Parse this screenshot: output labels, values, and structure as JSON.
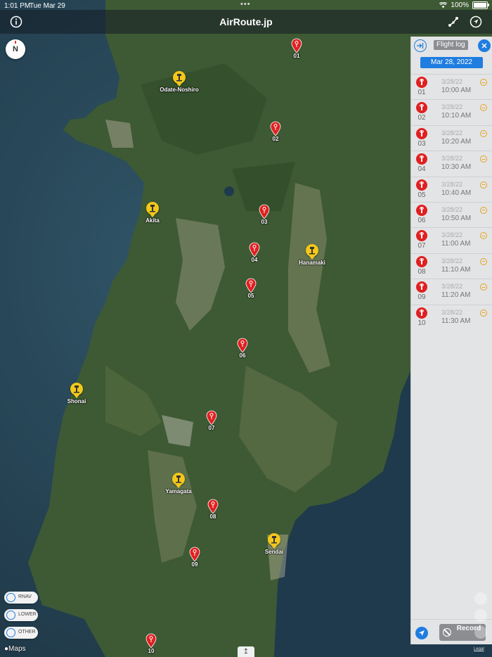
{
  "status_bar": {
    "time": "1:01 PM",
    "date": "Tue Mar 29",
    "battery": "100%"
  },
  "top_bar": {
    "title": "AirRoute.jp"
  },
  "compass": {
    "label": "N"
  },
  "airports": [
    {
      "name": "Odate-Noshiro"
    },
    {
      "name": "Akita"
    },
    {
      "name": "Hanamaki"
    },
    {
      "name": "Shonai"
    },
    {
      "name": "Yamagata"
    },
    {
      "name": "Sendai"
    }
  ],
  "waypoints": [
    "01",
    "02",
    "03",
    "04",
    "05",
    "06",
    "07",
    "08",
    "09",
    "10"
  ],
  "flight_log": {
    "title": "Flight log",
    "date": "Mar 28, 2022",
    "entries": [
      {
        "num": "01",
        "date": "3/28/22",
        "time": "10:00 AM"
      },
      {
        "num": "02",
        "date": "3/28/22",
        "time": "10:10 AM"
      },
      {
        "num": "03",
        "date": "3/28/22",
        "time": "10:20 AM"
      },
      {
        "num": "04",
        "date": "3/28/22",
        "time": "10:30 AM"
      },
      {
        "num": "05",
        "date": "3/28/22",
        "time": "10:40 AM"
      },
      {
        "num": "06",
        "date": "3/28/22",
        "time": "10:50 AM"
      },
      {
        "num": "07",
        "date": "3/28/22",
        "time": "11:00 AM"
      },
      {
        "num": "08",
        "date": "3/28/22",
        "time": "11:10 AM"
      },
      {
        "num": "09",
        "date": "3/28/22",
        "time": "11:20 AM"
      },
      {
        "num": "10",
        "date": "3/28/22",
        "time": "11:30 AM"
      }
    ],
    "record_label": "Record"
  },
  "filters": [
    {
      "label": "RNAV"
    },
    {
      "label": "LOWER"
    },
    {
      "label": "OTHER"
    }
  ],
  "footer": {
    "maps_label": "Maps",
    "legal_label": "Legal"
  },
  "colors": {
    "accent": "#1f7de0",
    "waypoint": "#e02020",
    "airport": "#f3c81a"
  }
}
